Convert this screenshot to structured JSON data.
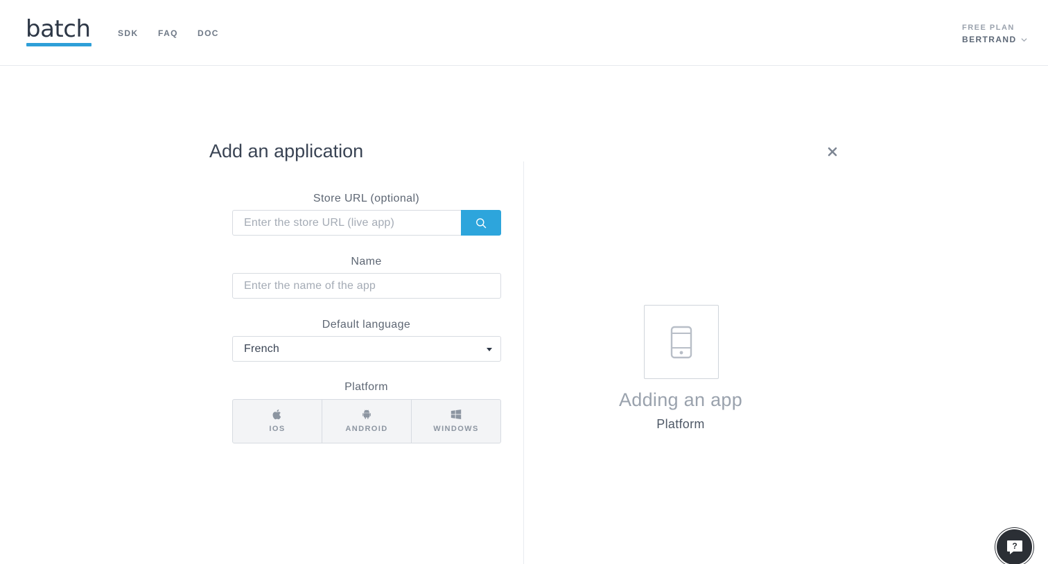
{
  "header": {
    "logo": "batch",
    "nav": [
      {
        "label": "SDK"
      },
      {
        "label": "FAQ"
      },
      {
        "label": "DOC"
      }
    ],
    "account": {
      "plan": "FREE PLAN",
      "user": "BERTRAND"
    }
  },
  "modal": {
    "title": "Add an application",
    "store_url": {
      "label": "Store URL (optional)",
      "placeholder": "Enter the store URL (live app)",
      "value": ""
    },
    "name": {
      "label": "Name",
      "placeholder": "Enter the name of the app",
      "value": ""
    },
    "language": {
      "label": "Default language",
      "selected": "French"
    },
    "platform": {
      "label": "Platform",
      "options": [
        {
          "label": "IOS",
          "icon": "apple-icon"
        },
        {
          "label": "ANDROID",
          "icon": "android-icon"
        },
        {
          "label": "WINDOWS",
          "icon": "windows-icon"
        }
      ]
    }
  },
  "preview": {
    "icon": "phone-icon",
    "title": "Adding an app",
    "subtitle": "Platform"
  },
  "colors": {
    "accent": "#2da5dc",
    "text": "#3a4454",
    "muted": "#9aa2ad"
  }
}
